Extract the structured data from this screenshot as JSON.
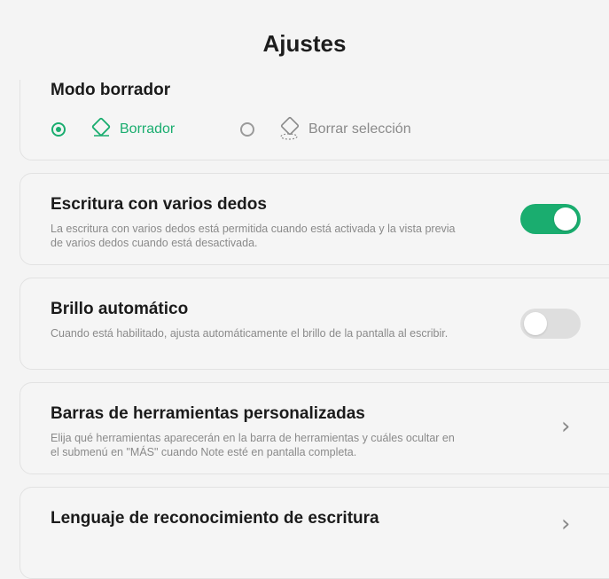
{
  "header": {
    "title": "Ajustes"
  },
  "eraser_mode": {
    "title": "Modo borrador",
    "options": [
      {
        "label": "Borrador",
        "icon": "eraser-icon",
        "selected": true
      },
      {
        "label": "Borrar selección",
        "icon": "eraser-lasso-icon",
        "selected": false
      }
    ]
  },
  "multi_finger": {
    "title": "Escritura con varios dedos",
    "description": "La escritura con varios dedos está permitida cuando está activada y la vista previa de varios dedos cuando está desactivada.",
    "enabled": true
  },
  "auto_brightness": {
    "title": "Brillo automático",
    "description": "Cuando está habilitado, ajusta automáticamente el brillo de la pantalla al escribir.",
    "enabled": false
  },
  "custom_toolbars": {
    "title": "Barras de herramientas personalizadas",
    "description": "Elija qué herramientas aparecerán en la barra de herramientas y cuáles ocultar en el submenú en \"MÁS\" cuando Note esté en pantalla completa."
  },
  "recognition_language": {
    "title": "Lenguaje de reconocimiento de escritura"
  },
  "colors": {
    "accent": "#1aad6f",
    "toggle_off": "#dedede",
    "text_secondary": "#8a8a8a"
  }
}
